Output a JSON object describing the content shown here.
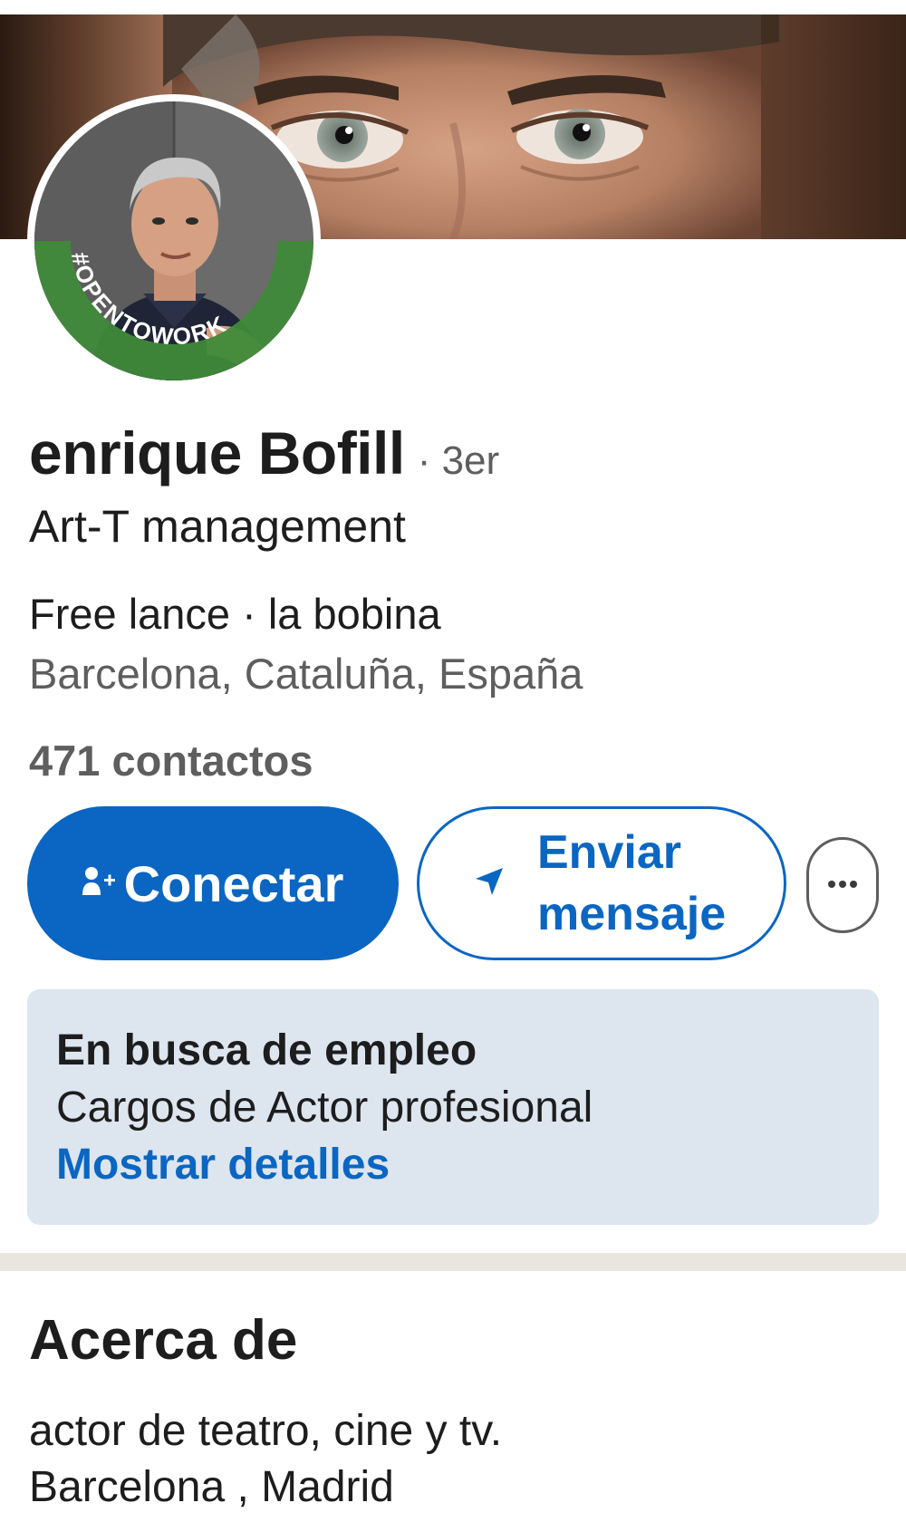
{
  "profile": {
    "name": "enrique Bofill",
    "degree": "· 3er",
    "headline": "Art-T management",
    "company": "Free lance · la bobina",
    "location": "Barcelona, Cataluña, España",
    "connections": "471 contactos",
    "avatar_frame_text": "#OPENTOWORK"
  },
  "actions": {
    "connect_label": "Conectar",
    "message_label": "Enviar mensaje",
    "more_label": "···"
  },
  "open_to_work": {
    "title": "En busca de empleo",
    "roles": "Cargos de Actor profesional",
    "link": "Mostrar detalles"
  },
  "about": {
    "title": "Acerca de",
    "line1": "actor de teatro, cine y tv.",
    "line2": "Barcelona , Madrid"
  },
  "colors": {
    "primary": "#0a66c2",
    "open_to_work_green": "#3f8a3a",
    "card_bg": "#dde5ef",
    "divider": "#e9e5df"
  },
  "icons": {
    "connect": "add-person-icon",
    "message": "send-icon",
    "more": "more-icon"
  }
}
